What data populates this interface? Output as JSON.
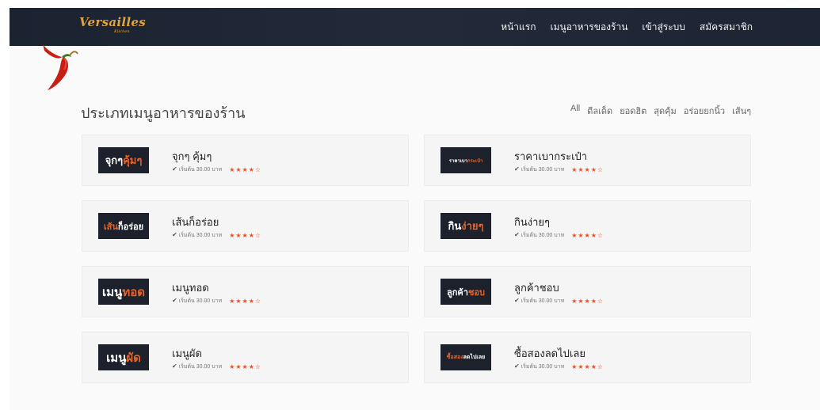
{
  "brand": {
    "logo": "Versailles",
    "sub": "Kitchen",
    "accent": "#e0a43a"
  },
  "nav": [
    {
      "label": "หน้าแรก"
    },
    {
      "label": "เมนูอาหารของร้าน"
    },
    {
      "label": "เข้าสู่ระบบ"
    },
    {
      "label": "สมัครสมาชิก"
    }
  ],
  "section": {
    "title": "ประเภทเมนูอาหารของร้าน"
  },
  "filters": [
    {
      "label": "All"
    },
    {
      "label": "ดีลเด็ด"
    },
    {
      "label": "ยอดฮิต"
    },
    {
      "label": "สุดคุ้ม"
    },
    {
      "label": "อร่อยยกนิ้ว"
    },
    {
      "label": "เส้นๆ"
    }
  ],
  "cards": [
    {
      "title": "จุกๆ คุ้มๆ",
      "thumb_white": "จุกๆ",
      "thumb_orange": "คุ้มๆ",
      "thumb_size": 13,
      "price": "เริ่มต้น 30.00 บาท",
      "rating": 4
    },
    {
      "title": "ราคาเบากระเป๋า",
      "thumb_white": "ราคาเบา",
      "thumb_orange": "กระเป๋า",
      "thumb_size": 6,
      "price": "เริ่มต้น 30.00 บาท",
      "rating": 4
    },
    {
      "title": "เส้นก็อร่อย",
      "thumb_white_first": false,
      "thumb_white": "ก็อร่อย",
      "thumb_orange": "เส้น",
      "thumb_size": 11,
      "price": "เริ่มต้น 30.00 บาท",
      "rating": 4
    },
    {
      "title": "กินง่ายๆ",
      "thumb_white": "กิน",
      "thumb_orange": "ง่ายๆ",
      "thumb_size": 13,
      "price": "เริ่มต้น 30.00 บาท",
      "rating": 4
    },
    {
      "title": "เมนูทอด",
      "thumb_white": "เมนู",
      "thumb_orange": "ทอด",
      "thumb_size": 15,
      "price": "เริ่มต้น 30.00 บาท",
      "rating": 4
    },
    {
      "title": "ลูกค้าชอบ",
      "thumb_white": "ลูกค้า",
      "thumb_orange": "ชอบ",
      "thumb_size": 11,
      "price": "เริ่มต้น 30.00 บาท",
      "rating": 4
    },
    {
      "title": "เมนูผัด",
      "thumb_white": "เมนู",
      "thumb_orange": "ผัด",
      "thumb_size": 15,
      "price": "เริ่มต้น 30.00 บาท",
      "rating": 4
    },
    {
      "title": "ซื้อสองลดไปเลย",
      "thumb_white_first": false,
      "thumb_white": "ลดไปเลย",
      "thumb_orange": "ซื้อสอง",
      "thumb_size": 7,
      "price": "เริ่มต้น 30.00 บาท",
      "rating": 4
    }
  ],
  "colors": {
    "navbar": "#1b2331",
    "accent_orange": "#e8632a",
    "star": "#e8501e"
  },
  "icons": {
    "chili": "chili-pepper-icon",
    "check": "check-icon",
    "star": "star-icon"
  }
}
